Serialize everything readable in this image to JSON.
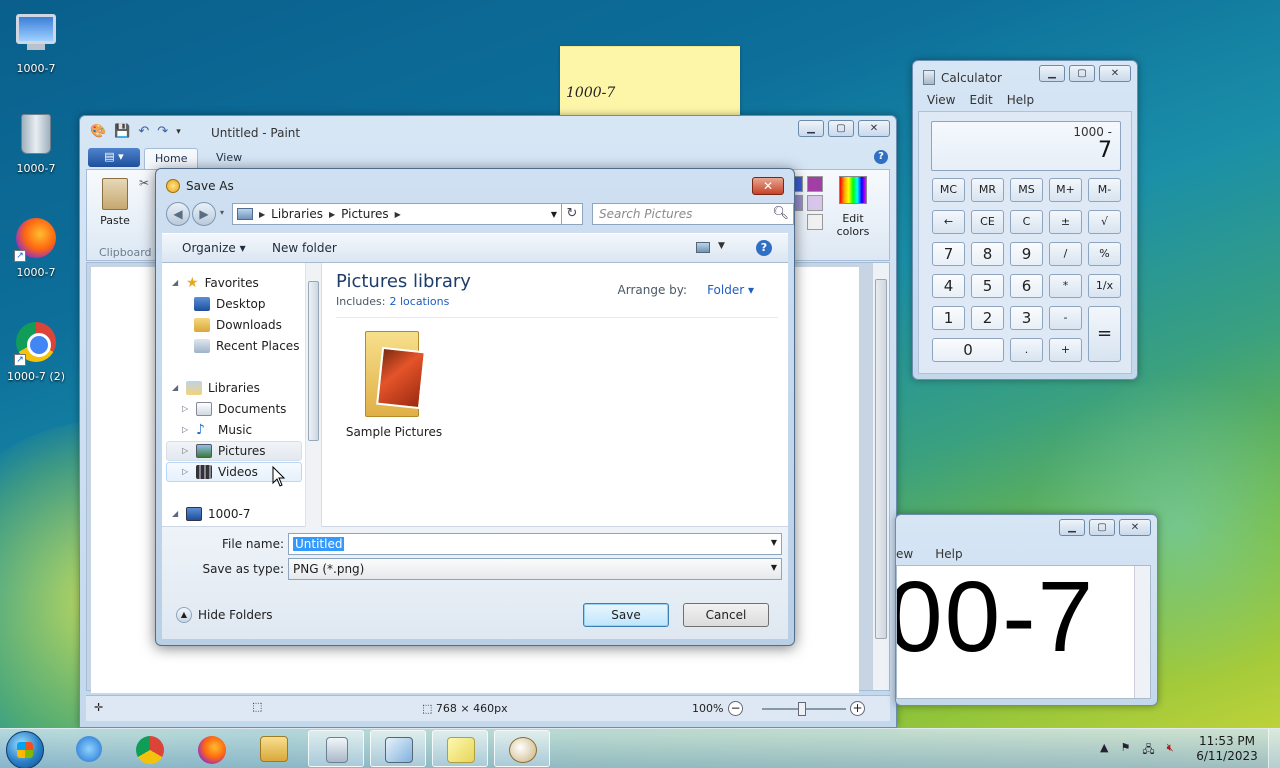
{
  "desktop": {
    "icons": [
      {
        "label": "1000-7",
        "icon": "computer-icon"
      },
      {
        "label": "1000-7",
        "icon": "recycle-bin-icon"
      },
      {
        "label": "1000-7",
        "icon": "firefox-icon"
      },
      {
        "label": "1000-7 (2)",
        "icon": "chrome-icon"
      }
    ]
  },
  "sticky_note": {
    "text": "1000-7"
  },
  "paint": {
    "title": "Untitled - Paint",
    "tabs": [
      "Home",
      "View"
    ],
    "paste_label": "Paste",
    "clipboard_label": "Clipboard",
    "edit_colors_label": "Edit colors",
    "status_dims": "768 × 460px",
    "zoom": "100%"
  },
  "calculator": {
    "title": "Calculator",
    "menu": [
      "View",
      "Edit",
      "Help"
    ],
    "history": "1000 -",
    "value": "7",
    "keys": [
      "MC",
      "MR",
      "MS",
      "M+",
      "M-",
      "←",
      "CE",
      "C",
      "±",
      "√",
      "7",
      "8",
      "9",
      "/",
      "%",
      "4",
      "5",
      "6",
      "*",
      "1/x",
      "1",
      "2",
      "3",
      "-",
      "=",
      "0",
      ".",
      "+"
    ]
  },
  "bigtext_window": {
    "menu": [
      "ew",
      "Help"
    ],
    "text": "00-7"
  },
  "save_as": {
    "title": "Save As",
    "breadcrumb": [
      "Libraries",
      "Pictures"
    ],
    "search_placeholder": "Search Pictures",
    "organize": "Organize",
    "new_folder": "New folder",
    "tree": {
      "favorites": "Favorites",
      "desktop": "Desktop",
      "downloads": "Downloads",
      "recent_places": "Recent Places",
      "libraries": "Libraries",
      "documents": "Documents",
      "music": "Music",
      "pictures": "Pictures",
      "videos": "Videos",
      "computer": "1000-7"
    },
    "library_title": "Pictures library",
    "includes_label": "Includes:",
    "includes_link": "2 locations",
    "arrange_label": "Arrange by:",
    "arrange_value": "Folder",
    "folder_item": "Sample Pictures",
    "file_name_label": "File name:",
    "file_name_value": "Untitled",
    "save_type_label": "Save as type:",
    "save_type_value": "PNG (*.png)",
    "hide_folders": "Hide Folders",
    "save_button": "Save",
    "cancel_button": "Cancel"
  },
  "taskbar": {
    "apps": [
      "internet-explorer-icon",
      "chrome-icon",
      "firefox-icon",
      "explorer-icon",
      "calculator-icon",
      "notepad-icon",
      "sticky-notes-icon",
      "paint-icon"
    ],
    "time": "11:53 PM",
    "date": "6/11/2023"
  }
}
